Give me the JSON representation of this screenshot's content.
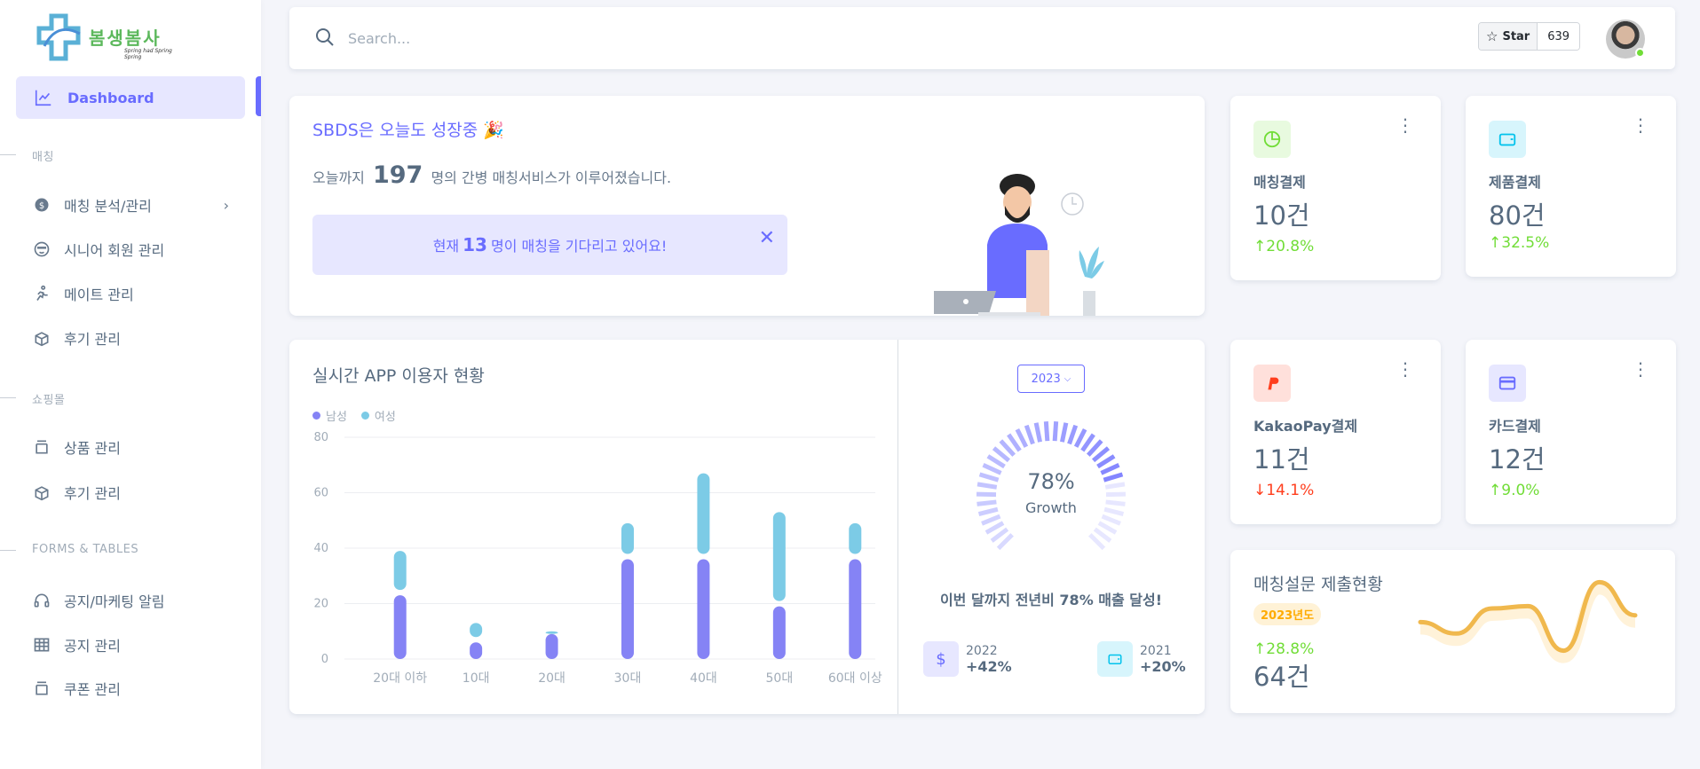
{
  "logo": {
    "text": "봄생봄사",
    "tagline": "Spring had Spring Spring"
  },
  "sidebar": {
    "active": {
      "label": "Dashboard"
    },
    "sections": [
      {
        "title": "매칭",
        "items": [
          {
            "label": "매칭 분석/관리",
            "icon": "dollar-circle-icon"
          },
          {
            "label": "시니어 회원 관리",
            "icon": "glasses-face-icon"
          },
          {
            "label": "메이트 관리",
            "icon": "running-icon"
          },
          {
            "label": "후기 관리",
            "icon": "gift-box-icon"
          }
        ]
      },
      {
        "title": "쇼핑몰",
        "items": [
          {
            "label": "상품 관리",
            "icon": "package-icon"
          },
          {
            "label": "후기 관리",
            "icon": "gift-box-icon"
          }
        ]
      },
      {
        "title": "FORMS & TABLES",
        "items": [
          {
            "label": "공지/마케팅 알림",
            "icon": "headset-icon"
          },
          {
            "label": "공지 관리",
            "icon": "table-icon"
          },
          {
            "label": "쿠폰 관리",
            "icon": "package-icon"
          }
        ]
      }
    ]
  },
  "topbar": {
    "search_placeholder": "Search...",
    "star_label": "Star",
    "star_count": "639"
  },
  "welcome": {
    "title": "SBDS은 오늘도 성장중 🎉",
    "sub_prefix": "오늘까지",
    "sub_count": "197",
    "sub_suffix": "명의 간병 매칭서비스가 이루어졌습니다.",
    "alert_prefix": "현재",
    "alert_count": "13",
    "alert_suffix": "명이 매칭을 기다리고 있어요!",
    "close": "✕"
  },
  "stats": [
    {
      "label": "매칭결제",
      "value": "10건",
      "change": "20.8%",
      "direction": "up",
      "icon": "pie-chart-icon",
      "color": "#71dd37"
    },
    {
      "label": "제품결제",
      "value": "80건",
      "change": "32.5%",
      "direction": "up",
      "icon": "wallet-icon",
      "color": "#03c3ec"
    },
    {
      "label": "KakaoPay결제",
      "value": "11건",
      "change": "14.1%",
      "direction": "down",
      "icon": "paypal-icon",
      "color": "#ff3e1d"
    },
    {
      "label": "카드결제",
      "value": "12건",
      "change": "9.0%",
      "direction": "up",
      "icon": "credit-card-icon",
      "color": "#696cff"
    }
  ],
  "chart_card": {
    "title": "실시간 APP 이용자 현황",
    "year": "2023",
    "growth_value": "78%",
    "growth_label": "Growth",
    "growth_text": "이번 달까지 전년비 78% 매출 달성!",
    "mini": [
      {
        "year": "2022",
        "pct": "+42%",
        "icon": "dollar-icon"
      },
      {
        "year": "2021",
        "pct": "+20%",
        "icon": "wallet-icon"
      }
    ]
  },
  "chart_data": {
    "type": "bar",
    "stacked": true,
    "categories": [
      "20대 이하",
      "10대",
      "20대",
      "30대",
      "40대",
      "50대",
      "60대 이상"
    ],
    "series": [
      {
        "name": "남성",
        "color": "#8583f5",
        "values": [
          23,
          6,
          9,
          36,
          36,
          19,
          36
        ]
      },
      {
        "name": "여성",
        "color": "#7ccbe6",
        "values": [
          16,
          7,
          1,
          13,
          31,
          34,
          13
        ]
      }
    ],
    "ylim": [
      0,
      80
    ],
    "yticks": [
      0,
      20,
      40,
      60,
      80
    ],
    "grid": true,
    "legend": "top-left"
  },
  "gauge": {
    "value": 78
  },
  "survey": {
    "title": "매칭설문 제출현황",
    "badge": "2023년도",
    "change": "28.8%",
    "value": "64건",
    "line": [
      30,
      20,
      42,
      44,
      5,
      65,
      36
    ]
  }
}
